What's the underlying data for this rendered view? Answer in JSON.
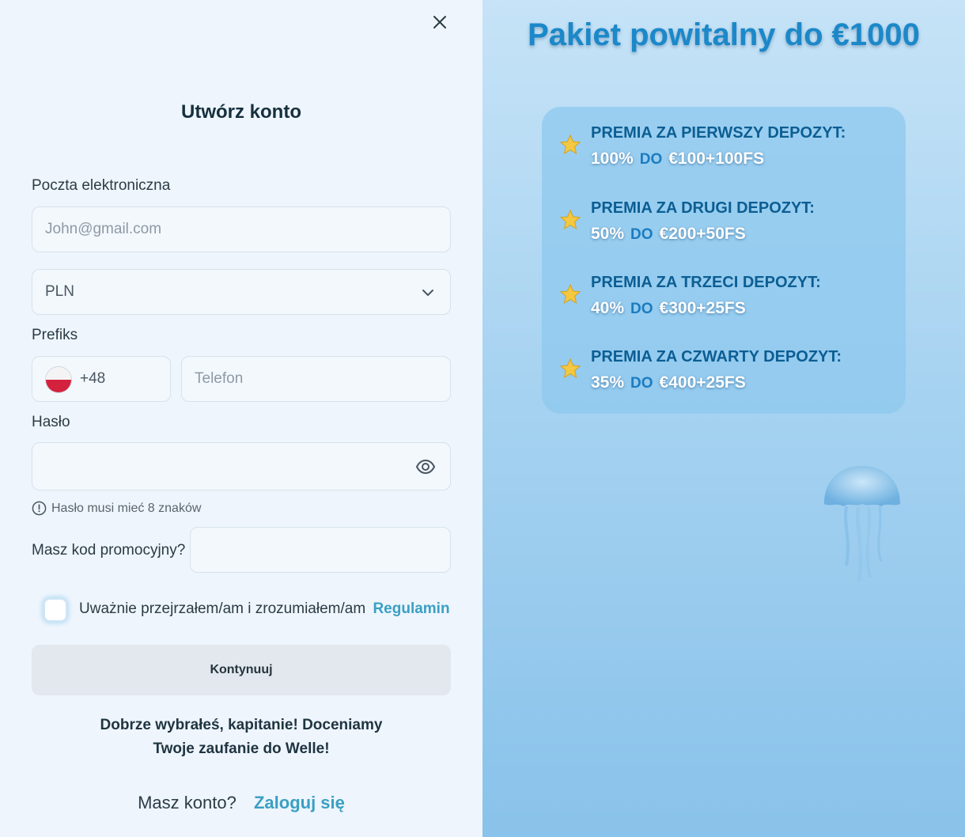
{
  "form": {
    "title": "Utwórz konto",
    "email_label": "Poczta elektroniczna",
    "email_placeholder": "John@gmail.com",
    "currency_value": "PLN",
    "prefix_label": "Prefiks",
    "prefix_code": "+48",
    "phone_placeholder": "Telefon",
    "password_label": "Hasło",
    "password_hint": "Hasło musi mieć 8 znaków",
    "promo_label": "Masz kod promocyjny?",
    "terms_text": "Uważnie przejrzałem/am i zrozumiałem/am",
    "terms_link": "Regulamin",
    "continue_label": "Kontynuuj",
    "welcome_line1": "Dobrze wybrałeś, kapitanie! Doceniamy",
    "welcome_line2": "Twoje zaufanie do Welle!",
    "have_account": "Masz konto?",
    "login_link": "Zaloguj się"
  },
  "promo": {
    "title": "Pakiet powitalny do €1000",
    "bonuses": [
      {
        "heading": "PREMIA ZA PIERWSZY DEPOZYT:",
        "percent": "100%",
        "do": "DO",
        "amount": "€100+100FS"
      },
      {
        "heading": "PREMIA ZA DRUGI DEPOZYT:",
        "percent": "50%",
        "do": "DO",
        "amount": "€200+50FS"
      },
      {
        "heading": "PREMIA ZA TRZECI DEPOZYT:",
        "percent": "40%",
        "do": "DO",
        "amount": "€300+25FS"
      },
      {
        "heading": "PREMIA ZA CZWARTY DEPOZYT:",
        "percent": "35%",
        "do": "DO",
        "amount": "€400+25FS"
      }
    ]
  },
  "icons": {
    "close": "close-icon",
    "chevron": "chevron-down-icon",
    "flag": "poland-flag-icon",
    "eye": "eye-icon",
    "info": "info-icon",
    "star": "star-icon",
    "jellyfish": "jellyfish-illustration"
  },
  "colors": {
    "accent_link": "#3aa0c3",
    "promo_title": "#1b88c9",
    "bonus_heading": "#0c5e93",
    "button_bg": "#e2e8ee"
  }
}
